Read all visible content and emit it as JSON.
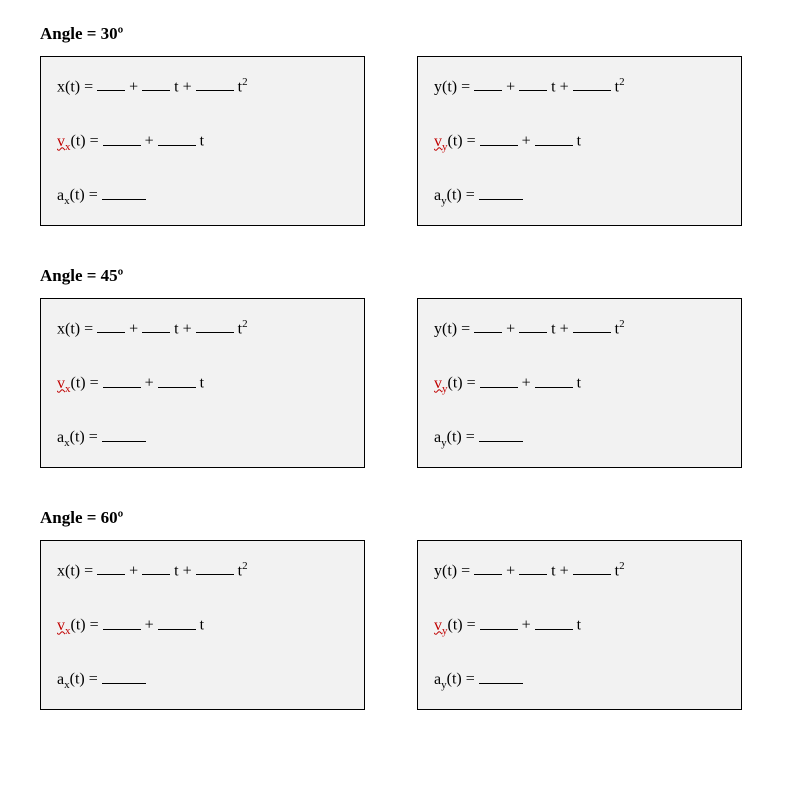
{
  "sections": [
    {
      "title": "Angle = 30º",
      "left": {
        "eq1": {
          "pos": "x",
          "var": "t"
        },
        "eq2": {
          "vvar": "v",
          "vsub": "x",
          "var": "t"
        },
        "eq3": {
          "avar": "a",
          "asub": "x",
          "var": "t"
        }
      },
      "right": {
        "eq1": {
          "pos": "y",
          "var": "t"
        },
        "eq2": {
          "vvar": "v",
          "vsub": "y",
          "var": "t"
        },
        "eq3": {
          "avar": "a",
          "asub": "y",
          "var": "t"
        }
      }
    },
    {
      "title": "Angle = 45º",
      "left": {
        "eq1": {
          "pos": "x",
          "var": "t"
        },
        "eq2": {
          "vvar": "v",
          "vsub": "x",
          "var": "t"
        },
        "eq3": {
          "avar": "a",
          "asub": "x",
          "var": "t"
        }
      },
      "right": {
        "eq1": {
          "pos": "y",
          "var": "t"
        },
        "eq2": {
          "vvar": "v",
          "vsub": "y",
          "var": "t"
        },
        "eq3": {
          "avar": "a",
          "asub": "y",
          "var": "t"
        }
      }
    },
    {
      "title": "Angle = 60º",
      "left": {
        "eq1": {
          "pos": "x",
          "var": "t"
        },
        "eq2": {
          "vvar": "v",
          "vsub": "x",
          "var": "t"
        },
        "eq3": {
          "avar": "a",
          "asub": "x",
          "var": "t"
        }
      },
      "right": {
        "eq1": {
          "pos": "y",
          "var": "t"
        },
        "eq2": {
          "vvar": "v",
          "vsub": "y",
          "var": "t"
        },
        "eq3": {
          "avar": "a",
          "asub": "y",
          "var": "t"
        }
      }
    }
  ],
  "plus": "+",
  "equals": "=",
  "tvar": "t",
  "tsq": "2"
}
